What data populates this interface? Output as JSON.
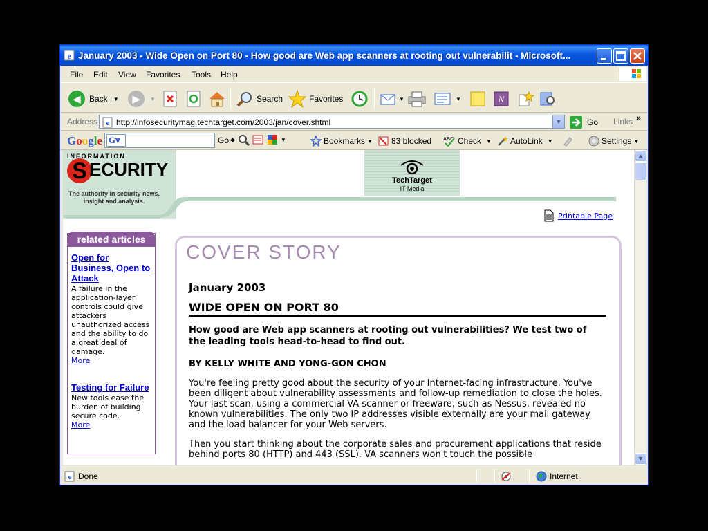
{
  "window": {
    "title": "January 2003 - Wide Open on Port 80 - How good are Web app scanners at rooting out vulnerabilit - Microsoft..."
  },
  "menu": [
    "File",
    "Edit",
    "View",
    "Favorites",
    "Tools",
    "Help"
  ],
  "toolbar": {
    "back_label": "Back",
    "search_label": "Search",
    "favorites_label": "Favorites"
  },
  "address": {
    "label": "Address",
    "url": "http://infosecuritymag.techtarget.com/2003/jan/cover.shtml",
    "go_label": "Go",
    "links_label": "Links"
  },
  "google_bar": {
    "logo": "Google",
    "go_label": "Go",
    "bookmarks_label": "Bookmarks",
    "blocked_label": "83 blocked",
    "check_label": "Check",
    "autolink_label": "AutoLink",
    "settings_label": "Settings"
  },
  "banner": {
    "logo_top": "INFORMATION",
    "logo_main": "ECURITY",
    "logo_s": "S",
    "tagline": "The authority in security news, insight and analysis.",
    "techtarget_name": "TechTarget",
    "techtarget_sub": "IT Media"
  },
  "printable_label": "Printable Page",
  "sidebar": {
    "heading": "related articles",
    "items": [
      {
        "title": "Open for Business, Open to Attack",
        "desc": "A failure in the application-layer controls could give attackers unauthorized access and the ability to do a great deal of damage.",
        "more": "More"
      },
      {
        "title": "Testing for Failure",
        "desc": "New tools ease the burden of building secure code.",
        "more": "More"
      }
    ]
  },
  "article": {
    "section": "COVER STORY",
    "date": "January 2003",
    "title": "WIDE OPEN ON PORT 80",
    "subtitle": "How good are Web app scanners at rooting out vulnerabilities? We test two of the leading tools head-to-head to find out.",
    "byline": "BY KELLY WHITE AND YONG-GON CHON",
    "para1": "You're feeling pretty good about the security of your Internet-facing infrastructure. You've been diligent about vulnerability assessments and follow-up remediation to close the holes. Your last scan, using a commercial VA scanner or freeware, such as Nessus, revealed no known vulnerabilities. The only two IP addresses visible externally are your mail gateway and the load balancer for your Web servers.",
    "para2": "Then you start thinking about the corporate sales and procurement applications that reside behind ports 80 (HTTP) and 443 (SSL). VA scanners won't touch the possible"
  },
  "status": {
    "text": "Done",
    "zone": "Internet"
  }
}
